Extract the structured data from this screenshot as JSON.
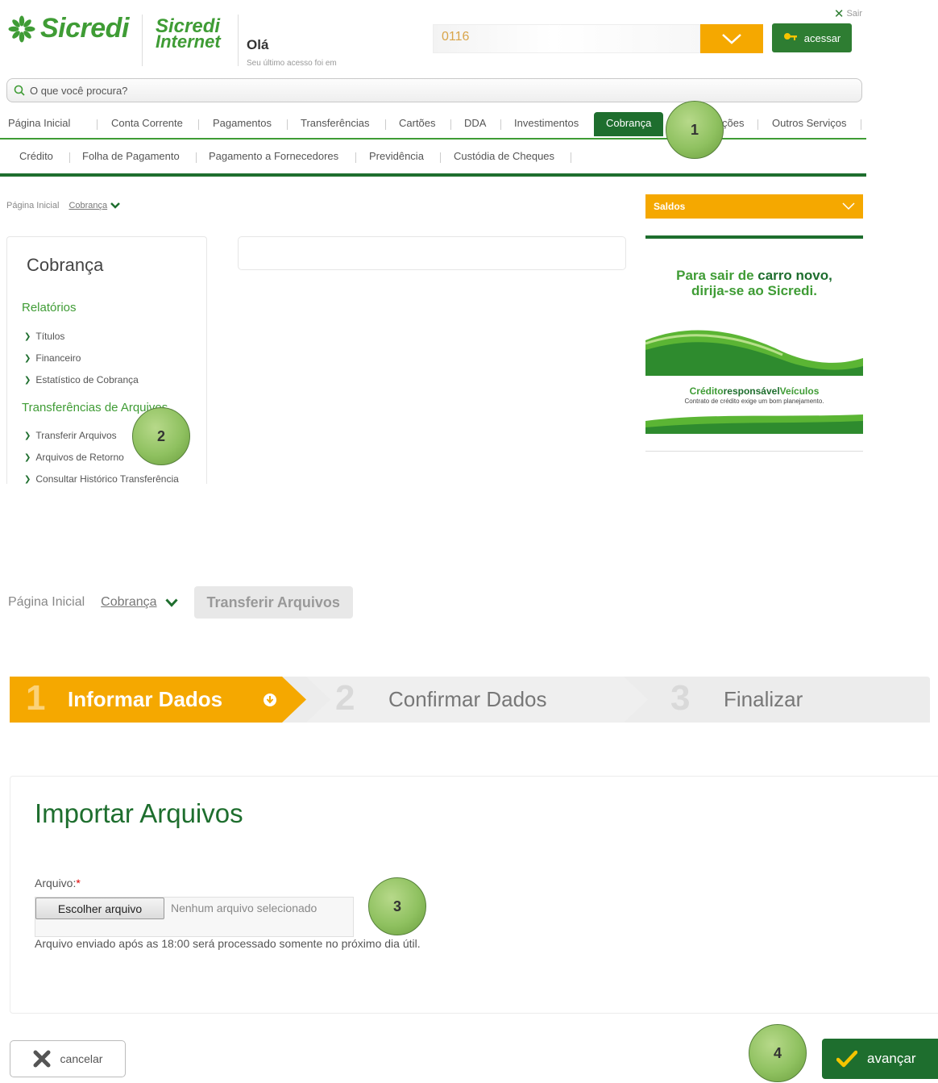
{
  "header": {
    "brand": "Sicredi",
    "product_line1": "Sicredi",
    "product_line2": "Internet",
    "greeting": "Olá",
    "last_access": "Seu último acesso foi em",
    "logout": "Sair",
    "account_value": "0116",
    "login_button": "acessar"
  },
  "search": {
    "placeholder": "O que você procura?"
  },
  "nav_main": {
    "items": [
      "Página Inicial",
      "Conta Corrente",
      "Pagamentos",
      "Transferências",
      "Cartões",
      "DDA",
      "Investimentos",
      "Cobrança",
      "ções",
      "Outros Serviços"
    ]
  },
  "nav_sub": {
    "items": [
      "Crédito",
      "Folha de Pagamento",
      "Pagamento a Fornecedores",
      "Previdência",
      "Custódia de Cheques"
    ]
  },
  "callouts": [
    "1",
    "2",
    "3",
    "4"
  ],
  "breadcrumb_top": {
    "home": "Página Inicial",
    "current": "Cobrança"
  },
  "sidebar": {
    "title": "Cobrança",
    "section1": "Relatórios",
    "section1_items": [
      "Títulos",
      "Financeiro",
      "Estatístico de Cobrança"
    ],
    "section2": "Transferências de Arquivos",
    "section2_items": [
      "Transferir Arquivos",
      "Arquivos de Retorno",
      "Consultar Histórico Transferência"
    ]
  },
  "saldos": {
    "label": "Saldos"
  },
  "ad": {
    "line1_a": "Para sair de ",
    "line1_b": "carro novo,",
    "line2": "dirija-se ao Sicredi.",
    "cap_a": "Crédito",
    "cap_b": "responsável",
    "cap_c": "Veículos",
    "cap_sub": "Contrato de crédito exige um bom planejamento."
  },
  "breadcrumb_bottom": {
    "home": "Página Inicial",
    "parent": "Cobrança",
    "current": "Transferir Arquivos"
  },
  "steps": [
    {
      "num": "1",
      "label": "Informar Dados"
    },
    {
      "num": "2",
      "label": "Confirmar Dados"
    },
    {
      "num": "3",
      "label": "Finalizar"
    }
  ],
  "form": {
    "title": "Importar Arquivos",
    "field_label": "Arquivo:",
    "required_mark": "*",
    "file_button": "Escolher arquivo",
    "file_status": "Nenhum arquivo selecionado",
    "note": "Arquivo enviado após as 18:00 será processado somente no próximo dia útil."
  },
  "actions": {
    "cancel": "cancelar",
    "next": "avançar"
  },
  "colors": {
    "green": "#3f9c35",
    "dark_green": "#1e6e2e",
    "orange": "#f5a800"
  }
}
